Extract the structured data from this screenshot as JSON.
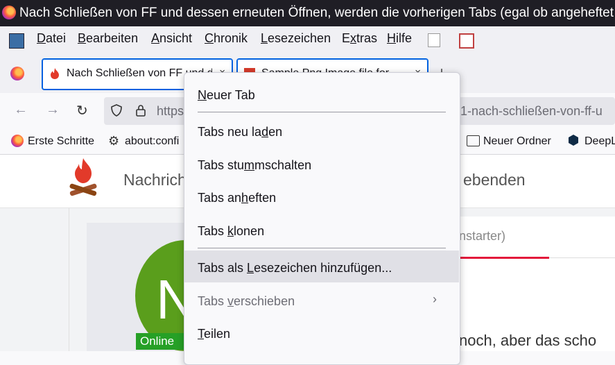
{
  "window": {
    "title": "Nach Schließen von FF und dessen erneuten Öffnen, werden die vorherigen Tabs (egal ob angeheftet"
  },
  "menubar": {
    "items": [
      {
        "pre": "",
        "key": "D",
        "post": "atei"
      },
      {
        "pre": "",
        "key": "B",
        "post": "earbeiten"
      },
      {
        "pre": "",
        "key": "A",
        "post": "nsicht"
      },
      {
        "pre": "",
        "key": "C",
        "post": "hronik"
      },
      {
        "pre": "",
        "key": "L",
        "post": "esezeichen"
      },
      {
        "pre": "E",
        "key": "x",
        "post": "tras"
      },
      {
        "pre": "",
        "key": "H",
        "post": "ilfe"
      }
    ]
  },
  "tabs": [
    {
      "label": "Nach Schließen von FF und dessen",
      "close": "×"
    },
    {
      "label": "Sample Png Image file for",
      "close": "×"
    }
  ],
  "newtab": "+",
  "url": {
    "start": "https:",
    "end": "1-nach-schließen-von-ff-u"
  },
  "bookmarks": [
    {
      "label": "Erste Schritte"
    },
    {
      "label": "about:confi"
    },
    {
      "label": "Neuer Ordner"
    },
    {
      "label": "DeepL"
    }
  ],
  "site": {
    "name_left": "Nachrich",
    "name_right": "ebenden",
    "avatar_letter": "N",
    "online": "Online",
    "tab_text": "nstarter)",
    "body_text": "noch, aber das scho"
  },
  "context_menu": {
    "items": [
      {
        "pre": "",
        "key": "N",
        "post": "euer Tab"
      },
      {
        "pre": "Tabs neu la",
        "key": "d",
        "post": "en"
      },
      {
        "pre": "Tabs stu",
        "key": "m",
        "post": "mschalten"
      },
      {
        "pre": "Tabs an",
        "key": "h",
        "post": "eften"
      },
      {
        "pre": "Tabs ",
        "key": "k",
        "post": "lonen"
      },
      {
        "pre": "Tabs als ",
        "key": "L",
        "post": "esezeichen hinzufügen..."
      },
      {
        "pre": "Tabs ",
        "key": "v",
        "post": "erschieben"
      },
      {
        "pre": "",
        "key": "T",
        "post": "eilen"
      }
    ]
  },
  "colors": {
    "accent": "#0061e0",
    "titlebar": "#1f1e25",
    "online": "#26a026",
    "highlight": "#e3193b"
  }
}
